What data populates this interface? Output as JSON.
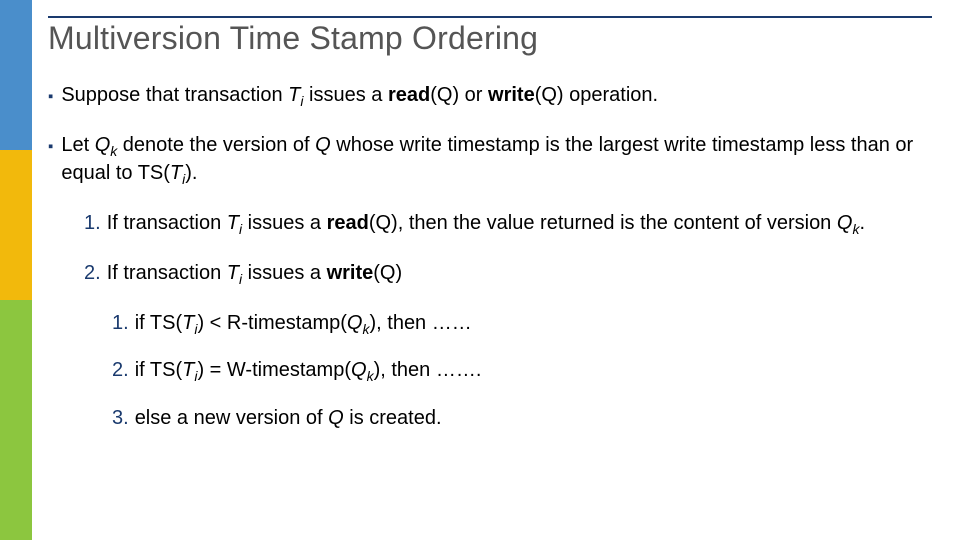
{
  "slide": {
    "title": "Multiversion Time Stamp Ordering",
    "bullet1": {
      "pre": "Suppose that transaction ",
      "Ti_T": "T",
      "Ti_i": "i",
      "mid1": " issues a ",
      "read": "read",
      "arg": "(Q)",
      "or": " or ",
      "write": "write",
      "arg2": "(Q) operation."
    },
    "bullet2": {
      "pre": "Let ",
      "Qk_Q": "Q",
      "Qk_k": "k",
      "mid": " denote the version of ",
      "Q": "Q",
      "rest": " whose write timestamp is the largest write timestamp less than or equal to TS(",
      "Ti_T": "T",
      "Ti_i": "i",
      "end": ")."
    },
    "n1": {
      "num": "1.",
      "pre": "If transaction ",
      "Ti_T": "T",
      "Ti_i": "i",
      "mid": " issues a ",
      "read": "read",
      "arg": "(Q), then the value returned is the content of version ",
      "Qk_Q": "Q",
      "Qk_k": "k",
      "end": "."
    },
    "n2": {
      "num": "2.",
      "pre": "If transaction ",
      "Ti_T": "T",
      "Ti_i": "i",
      "mid": " issues a  ",
      "write": "write",
      "arg": "(Q)"
    },
    "s1": {
      "num": "1.",
      "pre": "if TS(",
      "Ti_T": "T",
      "Ti_i": "i",
      "mid": ") < R-timestamp(",
      "Qk_Q": "Q",
      "Qk_k": "k",
      "end": "), then ……"
    },
    "s2": {
      "num": "2.",
      "pre": "if TS(",
      "Ti_T": "T",
      "Ti_i": "i",
      "mid": ") = W-timestamp(",
      "Qk_Q": "Q",
      "Qk_k": "k",
      "end": "), then ……."
    },
    "s3": {
      "num": "3.",
      "text": "else a new version of ",
      "Q": "Q",
      "end": " is created."
    }
  }
}
